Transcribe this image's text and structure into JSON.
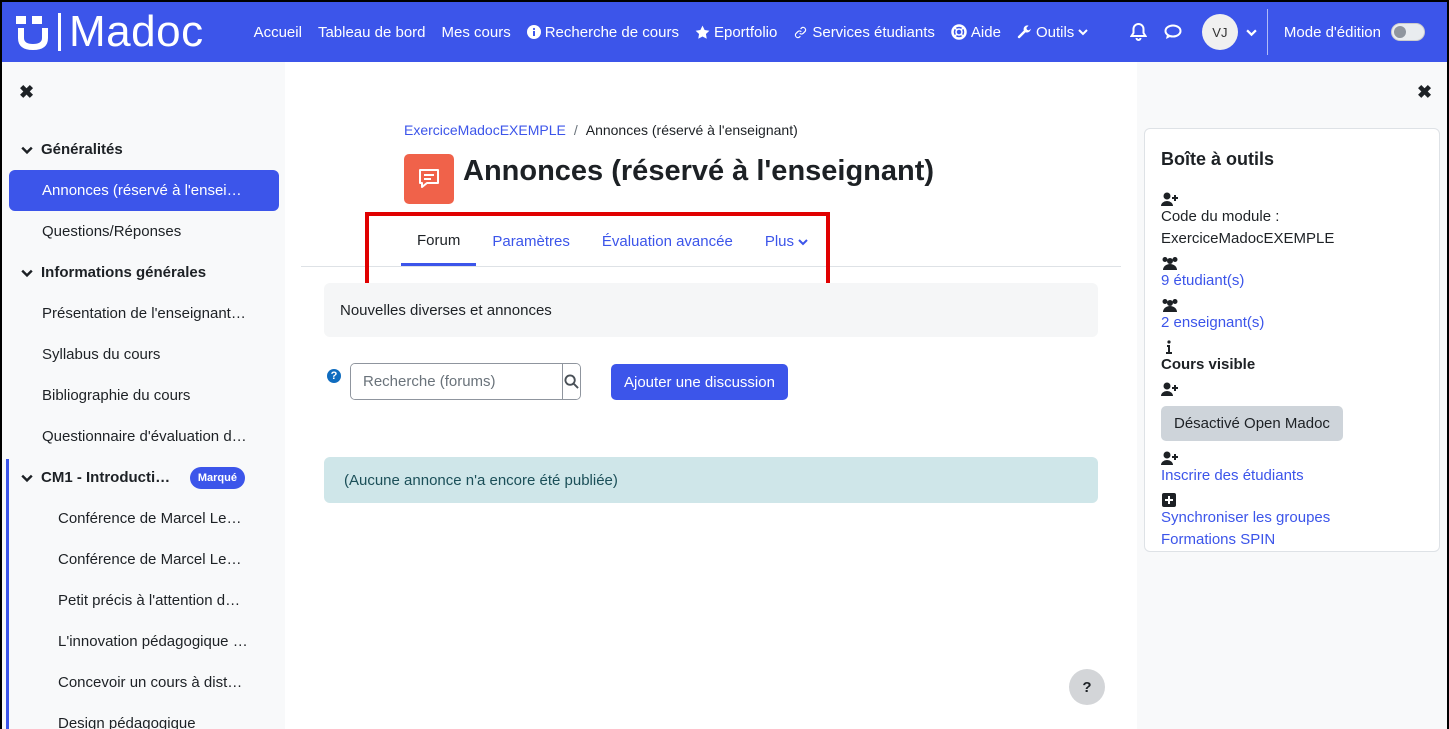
{
  "brand": {
    "name": "Madoc"
  },
  "nav": {
    "items": [
      {
        "label": "Accueil",
        "icon": ""
      },
      {
        "label": "Tableau de bord",
        "icon": ""
      },
      {
        "label": "Mes cours",
        "icon": ""
      },
      {
        "label": "Recherche de cours",
        "icon": "info-circle-icon"
      },
      {
        "label": "Eportfolio",
        "icon": "star-icon"
      },
      {
        "label": "Services étudiants",
        "icon": "link-icon"
      },
      {
        "label": "Aide",
        "icon": "lifebuoy-icon"
      },
      {
        "label": "Outils",
        "icon": "wrench-icon"
      }
    ],
    "avatar_initials": "VJ",
    "edit_mode_label": "Mode d'édition",
    "edit_mode_on": false
  },
  "course_index": {
    "items": [
      {
        "type": "section",
        "label": "Généralités"
      },
      {
        "type": "item",
        "label": "Annonces (réservé à l'enseignant)",
        "active": true
      },
      {
        "type": "item",
        "label": "Questions/Réponses"
      },
      {
        "type": "section",
        "label": "Informations générales"
      },
      {
        "type": "item",
        "label": "Présentation de l'enseignant responsable"
      },
      {
        "type": "item",
        "label": "Syllabus du cours"
      },
      {
        "type": "item",
        "label": "Bibliographie du cours"
      },
      {
        "type": "item",
        "label": "Questionnaire d'évaluation du cours"
      },
      {
        "type": "section",
        "label": "CM1 - Introduction",
        "badge": "Marqué"
      },
      {
        "type": "sub",
        "label": "Conférence de Marcel Lebrun"
      },
      {
        "type": "sub",
        "label": "Conférence de Marcel Lebrun (suite)"
      },
      {
        "type": "sub",
        "label": "Petit précis à l'attention des enseignants"
      },
      {
        "type": "sub",
        "label": "L'innovation pédagogique en question"
      },
      {
        "type": "sub",
        "label": "Concevoir un cours à distance"
      },
      {
        "type": "sub",
        "label": "Design pédagogique"
      }
    ]
  },
  "breadcrumb": {
    "course": "ExerciceMadocEXEMPLE",
    "separator": "/",
    "current": "Annonces (réservé à l'enseignant)"
  },
  "page": {
    "title": "Annonces (réservé à l'enseignant)",
    "tabs": [
      {
        "label": "Forum",
        "active": true
      },
      {
        "label": "Paramètres"
      },
      {
        "label": "Évaluation avancée"
      },
      {
        "label": "Plus",
        "dropdown": true
      }
    ],
    "intro": "Nouvelles diverses et annonces",
    "search_placeholder": "Recherche (forums)",
    "add_discussion": "Ajouter une discussion",
    "empty_notice": "(Aucune annonce n'a encore été publiée)",
    "help_fab": "?"
  },
  "toolbox": {
    "title": "Boîte à outils",
    "module_code_label": "Code du module :",
    "module_code": "ExerciceMadocEXEMPLE",
    "students_link": "9 étudiant(s)",
    "teachers_link": "2 enseignant(s)",
    "visibility": "Cours visible",
    "open_madoc_button": "Désactivé Open Madoc",
    "enrol_link": "Inscrire des étudiants",
    "sync_link": "Synchroniser les groupes",
    "spin_link": "Formations SPIN"
  },
  "colors": {
    "brand": "#3c55ea",
    "activity_icon": "#f0624a",
    "highlight": "#e00000",
    "alert_bg": "#cfe6e9"
  }
}
